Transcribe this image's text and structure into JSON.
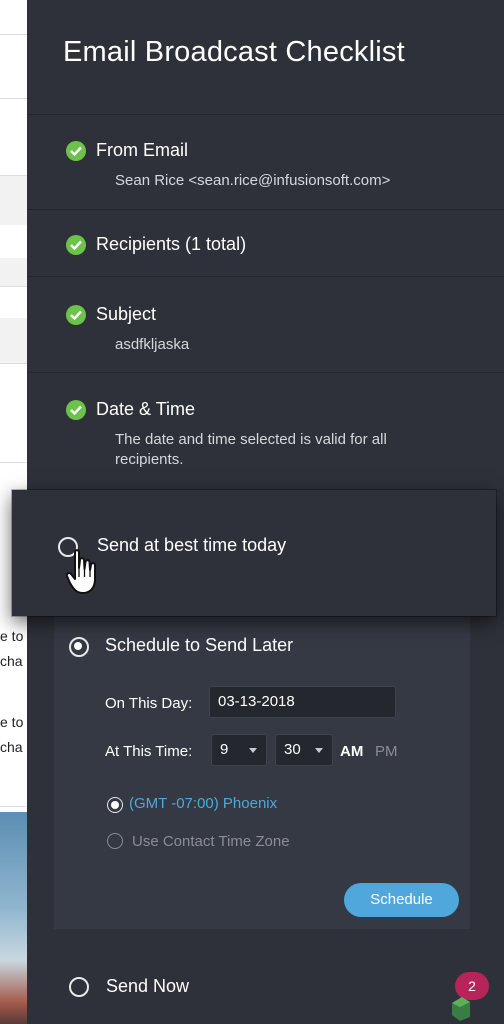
{
  "background": {
    "text_fragments": [
      "e to",
      "cha",
      "e to",
      "cha"
    ]
  },
  "checklist": {
    "title": "Email Broadcast Checklist",
    "items": [
      {
        "title": "From Email",
        "subtitle": "Sean Rice <sean.rice@infusionsoft.com>",
        "status": "complete"
      },
      {
        "title": "Recipients (1 total)",
        "subtitle": "",
        "status": "complete"
      },
      {
        "title": "Subject",
        "subtitle": "asdfkljaska",
        "status": "complete"
      },
      {
        "title": "Date & Time",
        "subtitle_line1": "The date and time selected is valid for all",
        "subtitle_line2": "recipients.",
        "status": "complete"
      }
    ]
  },
  "send_options": {
    "best_time": {
      "label": "Send at best time today",
      "selected": false
    },
    "schedule_later": {
      "label": "Schedule to Send Later",
      "selected": true,
      "day_label": "On This Day:",
      "day_value": "03-13-2018",
      "time_label": "At This Time:",
      "hour": "9",
      "minute": "30",
      "am": "AM",
      "pm": "PM",
      "selected_period": "AM",
      "timezone_options": [
        {
          "label": "(GMT -07:00) Phoenix",
          "selected": true
        },
        {
          "label": "Use Contact Time Zone",
          "selected": false
        }
      ],
      "schedule_button": "Schedule"
    },
    "send_now": {
      "label": "Send Now",
      "selected": false
    }
  },
  "notification_badge": "2",
  "colors": {
    "panel_bg": "#2e3139",
    "check_green": "#6cc24a",
    "link_blue": "#4fa7dc",
    "badge": "#b6245a"
  }
}
